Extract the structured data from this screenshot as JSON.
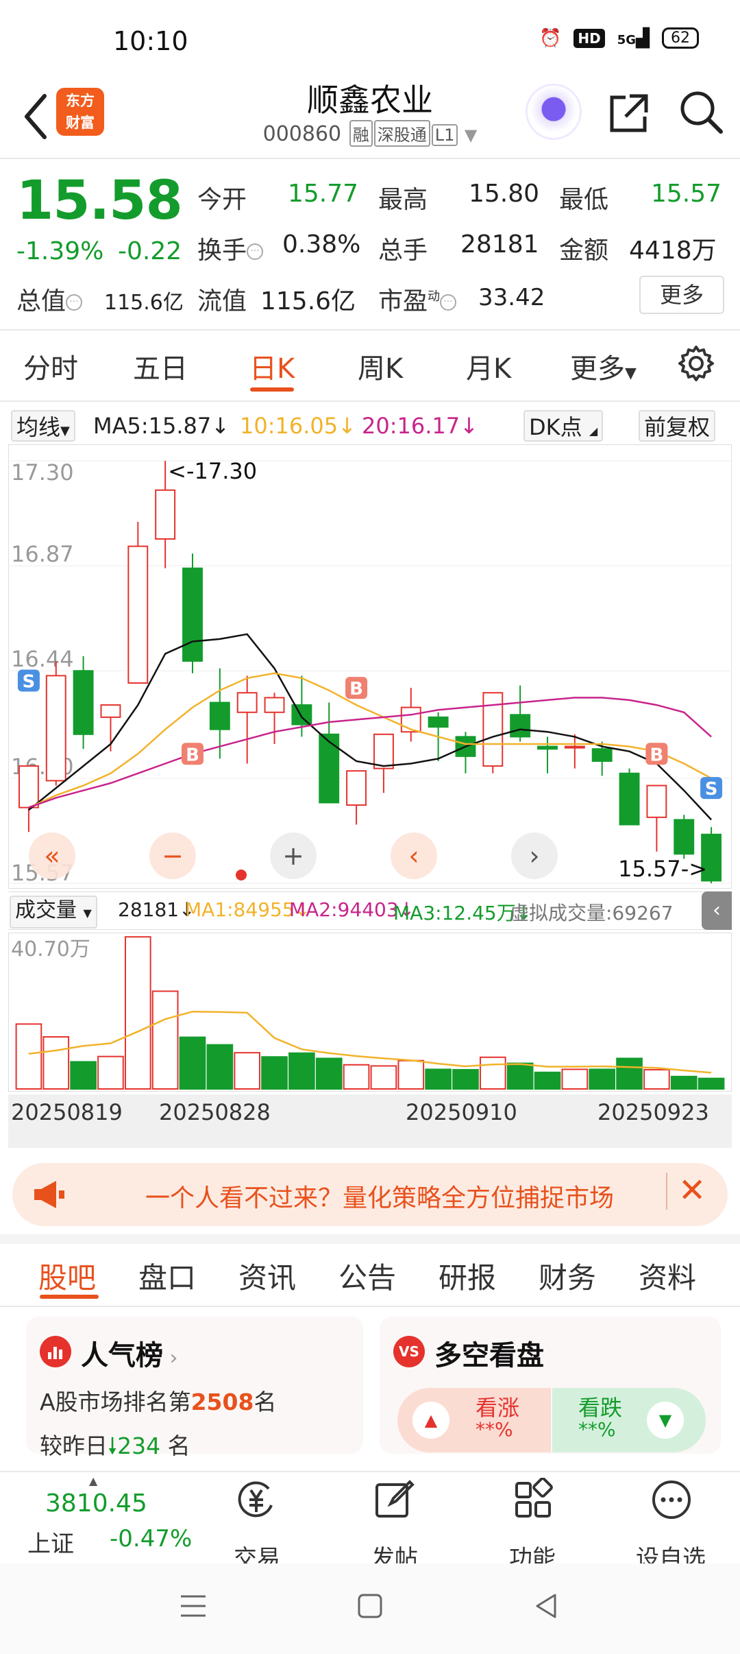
{
  "status": {
    "time": "10:10",
    "network": "5G",
    "hd": "HD",
    "battery": "62"
  },
  "header": {
    "stock_name": "顺鑫农业",
    "stock_code": "000860",
    "tags": [
      "融",
      "深股通",
      "L1"
    ],
    "logo_line1": "东方",
    "logo_line2": "财富"
  },
  "quote": {
    "price": "15.58",
    "change_pct": "-1.39%",
    "change_abs": "-0.22",
    "open_label": "今开",
    "open": "15.77",
    "high_label": "最高",
    "high": "15.80",
    "low_label": "最低",
    "low": "15.57",
    "turnover_label": "换手",
    "turnover": "0.38%",
    "volume_label": "总手",
    "volume": "28181",
    "amount_label": "金额",
    "amount": "4418万",
    "mktcap_label": "总值",
    "mktcap": "115.6亿",
    "float_label": "流值",
    "float": "115.6亿",
    "pe_label": "市盈",
    "pe_sup": "动",
    "pe": "33.42",
    "more": "更多"
  },
  "period_tabs": [
    "分时",
    "五日",
    "日K",
    "周K",
    "月K",
    "更多"
  ],
  "ma_bar": {
    "type": "均线",
    "ma5": "MA5:15.87",
    "ma10": "10:16.05",
    "ma20": "20:16.17",
    "dk": "DK点",
    "adjust": "前复权"
  },
  "vol_bar": {
    "type": "成交量",
    "vol": "28181",
    "ma1": "MA1:84955",
    "ma2": "MA2:94403",
    "ma3": "MA3:12.45万",
    "virtual": "虚拟成交量:69267"
  },
  "colors": {
    "up": "#e5322d",
    "down": "#139c2c",
    "ma5": "#111111",
    "ma10": "#f2b22a",
    "ma20": "#c8248a",
    "accent": "#e8511c"
  },
  "chart_data": {
    "type": "candlestick",
    "ylim": [
      15.57,
      17.3
    ],
    "y_ticks": [
      "17.30",
      "16.87",
      "16.44",
      "16.00",
      "15.57"
    ],
    "max_label": "<-17.30",
    "min_label": "15.57->",
    "x_ticks": [
      "20250819",
      "20250828",
      "20250910",
      "20250923"
    ],
    "candles": [
      {
        "o": 15.88,
        "h": 16.05,
        "l": 15.78,
        "c": 16.05
      },
      {
        "o": 15.99,
        "h": 16.48,
        "l": 15.97,
        "c": 16.42
      },
      {
        "o": 16.44,
        "h": 16.5,
        "l": 16.12,
        "c": 16.18
      },
      {
        "o": 16.25,
        "h": 16.3,
        "l": 16.11,
        "c": 16.3
      },
      {
        "o": 16.39,
        "h": 17.05,
        "l": 16.39,
        "c": 16.95
      },
      {
        "o": 16.98,
        "h": 17.3,
        "l": 16.86,
        "c": 17.18
      },
      {
        "o": 16.86,
        "h": 16.92,
        "l": 16.43,
        "c": 16.48
      },
      {
        "o": 16.31,
        "h": 16.45,
        "l": 16.08,
        "c": 16.2
      },
      {
        "o": 16.27,
        "h": 16.42,
        "l": 16.06,
        "c": 16.35
      },
      {
        "o": 16.27,
        "h": 16.35,
        "l": 16.14,
        "c": 16.33
      },
      {
        "o": 16.3,
        "h": 16.42,
        "l": 16.17,
        "c": 16.22
      },
      {
        "o": 16.18,
        "h": 16.31,
        "l": 15.9,
        "c": 15.9
      },
      {
        "o": 15.89,
        "h": 16.0,
        "l": 15.81,
        "c": 16.03
      },
      {
        "o": 16.04,
        "h": 16.17,
        "l": 15.94,
        "c": 16.18
      },
      {
        "o": 16.19,
        "h": 16.37,
        "l": 16.15,
        "c": 16.29
      },
      {
        "o": 16.25,
        "h": 16.27,
        "l": 16.07,
        "c": 16.21
      },
      {
        "o": 16.17,
        "h": 16.19,
        "l": 16.02,
        "c": 16.09
      },
      {
        "o": 16.05,
        "h": 16.34,
        "l": 16.02,
        "c": 16.35
      },
      {
        "o": 16.26,
        "h": 16.38,
        "l": 16.15,
        "c": 16.17
      },
      {
        "o": 16.13,
        "h": 16.17,
        "l": 16.02,
        "c": 16.12
      },
      {
        "o": 16.13,
        "h": 16.18,
        "l": 16.04,
        "c": 16.13
      },
      {
        "o": 16.12,
        "h": 16.15,
        "l": 16.01,
        "c": 16.07
      },
      {
        "o": 16.02,
        "h": 16.04,
        "l": 15.82,
        "c": 15.81
      },
      {
        "o": 15.84,
        "h": 15.92,
        "l": 15.7,
        "c": 15.97
      },
      {
        "o": 15.83,
        "h": 15.85,
        "l": 15.67,
        "c": 15.69
      },
      {
        "o": 15.77,
        "h": 15.8,
        "l": 15.57,
        "c": 15.58
      }
    ],
    "series": [
      {
        "name": "MA5",
        "values": [
          15.87,
          15.96,
          16.05,
          16.14,
          16.3,
          16.51,
          16.56,
          16.57,
          16.59,
          16.45,
          16.25,
          16.15,
          16.07,
          16.05,
          16.06,
          16.08,
          16.13,
          16.17,
          16.2,
          16.19,
          16.17,
          16.13,
          16.11,
          16.06,
          15.95,
          15.83
        ]
      },
      {
        "name": "MA10",
        "values": [
          15.88,
          15.93,
          15.97,
          16.02,
          16.1,
          16.2,
          16.29,
          16.36,
          16.41,
          16.43,
          16.41,
          16.36,
          16.3,
          16.25,
          16.2,
          16.17,
          16.14,
          16.14,
          16.14,
          16.14,
          16.14,
          16.14,
          16.13,
          16.11,
          16.06,
          16.0
        ]
      },
      {
        "name": "MA20",
        "values": [
          15.88,
          15.92,
          15.95,
          15.98,
          16.02,
          16.06,
          16.1,
          16.13,
          16.16,
          16.19,
          16.21,
          16.23,
          16.24,
          16.25,
          16.26,
          16.28,
          16.29,
          16.3,
          16.31,
          16.32,
          16.33,
          16.33,
          16.32,
          16.3,
          16.27,
          16.17
        ]
      }
    ],
    "volume": {
      "ylim": [
        0,
        40.7
      ],
      "y_tick": "40.70万",
      "values": [
        17.2,
        13.8,
        7.2,
        8.6,
        40.3,
        25.9,
        13.7,
        11.7,
        9.6,
        8.5,
        9.5,
        8.1,
        6.4,
        6.1,
        7.5,
        5.2,
        5.1,
        8.4,
        6.8,
        4.4,
        5.2,
        5.2,
        8.1,
        5.1,
        3.3,
        2.8
      ],
      "up": [
        true,
        true,
        false,
        true,
        true,
        true,
        false,
        false,
        true,
        false,
        false,
        false,
        true,
        true,
        true,
        false,
        false,
        true,
        false,
        false,
        true,
        false,
        false,
        true,
        false,
        false
      ],
      "ma_values": [
        [
          9.3,
          10.2,
          11.4,
          12.1,
          15.2,
          18.5,
          20.5,
          20.4,
          20.2,
          13.5,
          10.5,
          9.5,
          8.7,
          8.1,
          7.6,
          6.7,
          6.0,
          6.5,
          6.6,
          5.9,
          5.9,
          6.0,
          5.8,
          5.6,
          4.9,
          4.3
        ]
      ]
    }
  },
  "banner": {
    "text": "一个人看不过来？量化策略全方位捕捉市场"
  },
  "section_tabs": [
    "股吧",
    "盘口",
    "资讯",
    "公告",
    "研报",
    "财务",
    "资料"
  ],
  "popularity": {
    "title": "人气榜",
    "line1_pre": "A股市场排名第",
    "rank": "2508",
    "line1_post": "名",
    "line2_pre": "较昨日",
    "delta": "234",
    "line2_post": "名"
  },
  "longshort": {
    "title": "多空看盘",
    "up_label": "看涨",
    "up_val": "**%",
    "down_label": "看跌",
    "down_val": "**%"
  },
  "bottom": {
    "index_value": "3810.45",
    "index_name": "上证",
    "index_change": "-0.47%",
    "trade": "交易",
    "post": "发帖",
    "features": "功能",
    "watch": "设自选"
  }
}
